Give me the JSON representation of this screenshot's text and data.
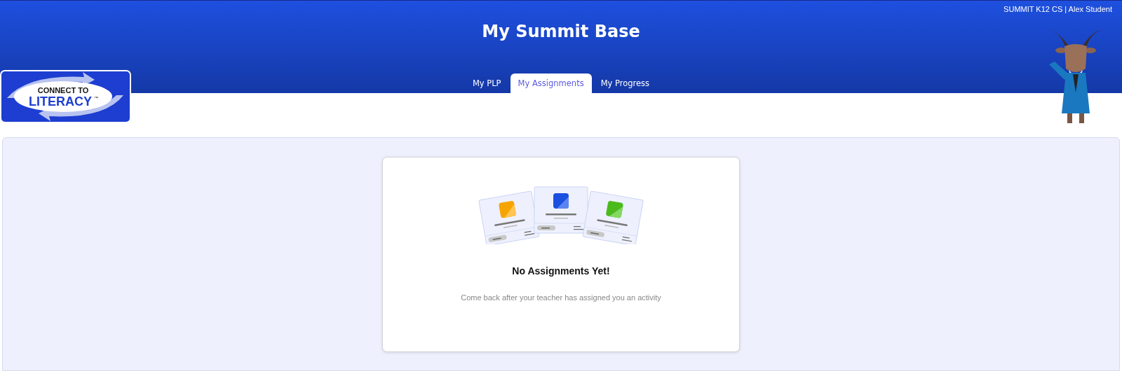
{
  "header": {
    "account": "SUMMIT K12 CS | Alex Student",
    "title": "My Summit Base"
  },
  "logo": {
    "line_1": "CONNECT TO",
    "line_2": "LITERACY",
    "mark": "™"
  },
  "tabs": [
    {
      "label": "My PLP",
      "selected": false
    },
    {
      "label": "My Assignments",
      "selected": true
    },
    {
      "label": "My Progress",
      "selected": false
    }
  ],
  "empty_state": {
    "title": "No Assignments Yet!",
    "message": "Come back after your teacher has assigned you an activity"
  }
}
